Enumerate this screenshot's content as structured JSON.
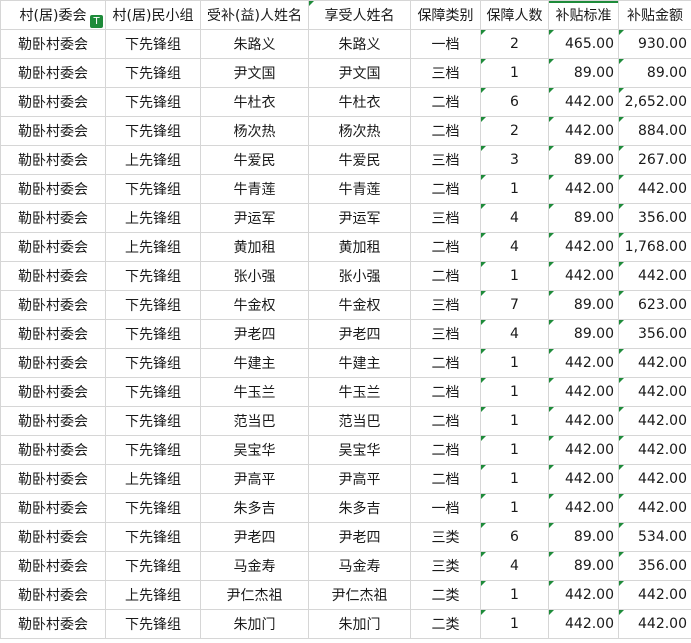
{
  "headers": [
    "村(居)委会",
    "村(居)民小组",
    "受补(益)人姓名",
    "享受人姓名",
    "保障类别",
    "保障人数",
    "补贴标准",
    "补贴金额"
  ],
  "rows": [
    [
      "勒卧村委会",
      "下先锋组",
      "朱路义",
      "朱路义",
      "一档",
      "2",
      "465.00",
      "930.00"
    ],
    [
      "勒卧村委会",
      "下先锋组",
      "尹文国",
      "尹文国",
      "三档",
      "1",
      "89.00",
      "89.00"
    ],
    [
      "勒卧村委会",
      "下先锋组",
      "牛杜衣",
      "牛杜衣",
      "二档",
      "6",
      "442.00",
      "2,652.00"
    ],
    [
      "勒卧村委会",
      "下先锋组",
      "杨次热",
      "杨次热",
      "二档",
      "2",
      "442.00",
      "884.00"
    ],
    [
      "勒卧村委会",
      "上先锋组",
      "牛爱民",
      "牛爱民",
      "三档",
      "3",
      "89.00",
      "267.00"
    ],
    [
      "勒卧村委会",
      "下先锋组",
      "牛青莲",
      "牛青莲",
      "二档",
      "1",
      "442.00",
      "442.00"
    ],
    [
      "勒卧村委会",
      "上先锋组",
      "尹运军",
      "尹运军",
      "三档",
      "4",
      "89.00",
      "356.00"
    ],
    [
      "勒卧村委会",
      "上先锋组",
      "黄加租",
      "黄加租",
      "二档",
      "4",
      "442.00",
      "1,768.00"
    ],
    [
      "勒卧村委会",
      "下先锋组",
      "张小强",
      "张小强",
      "二档",
      "1",
      "442.00",
      "442.00"
    ],
    [
      "勒卧村委会",
      "下先锋组",
      "牛金权",
      "牛金权",
      "三档",
      "7",
      "89.00",
      "623.00"
    ],
    [
      "勒卧村委会",
      "下先锋组",
      "尹老四",
      "尹老四",
      "三档",
      "4",
      "89.00",
      "356.00"
    ],
    [
      "勒卧村委会",
      "下先锋组",
      "牛建主",
      "牛建主",
      "二档",
      "1",
      "442.00",
      "442.00"
    ],
    [
      "勒卧村委会",
      "下先锋组",
      "牛玉兰",
      "牛玉兰",
      "二档",
      "1",
      "442.00",
      "442.00"
    ],
    [
      "勒卧村委会",
      "下先锋组",
      "范当巴",
      "范当巴",
      "二档",
      "1",
      "442.00",
      "442.00"
    ],
    [
      "勒卧村委会",
      "下先锋组",
      "吴宝华",
      "吴宝华",
      "二档",
      "1",
      "442.00",
      "442.00"
    ],
    [
      "勒卧村委会",
      "上先锋组",
      "尹高平",
      "尹高平",
      "二档",
      "1",
      "442.00",
      "442.00"
    ],
    [
      "勒卧村委会",
      "下先锋组",
      "朱多吉",
      "朱多吉",
      "一档",
      "1",
      "442.00",
      "442.00"
    ],
    [
      "勒卧村委会",
      "下先锋组",
      "尹老四",
      "尹老四",
      "三类",
      "6",
      "89.00",
      "534.00"
    ],
    [
      "勒卧村委会",
      "下先锋组",
      "马金寿",
      "马金寿",
      "三类",
      "4",
      "89.00",
      "356.00"
    ],
    [
      "勒卧村委会",
      "上先锋组",
      "尹仁杰祖",
      "尹仁杰祖",
      "二类",
      "1",
      "442.00",
      "442.00"
    ],
    [
      "勒卧村委会",
      "下先锋组",
      "朱加门",
      "朱加门",
      "二类",
      "1",
      "442.00",
      "442.00"
    ]
  ],
  "colors": {
    "accent": "#1e8b3a",
    "grid": "#d6d6d6"
  },
  "icons": {
    "filter": "filter-icon"
  }
}
